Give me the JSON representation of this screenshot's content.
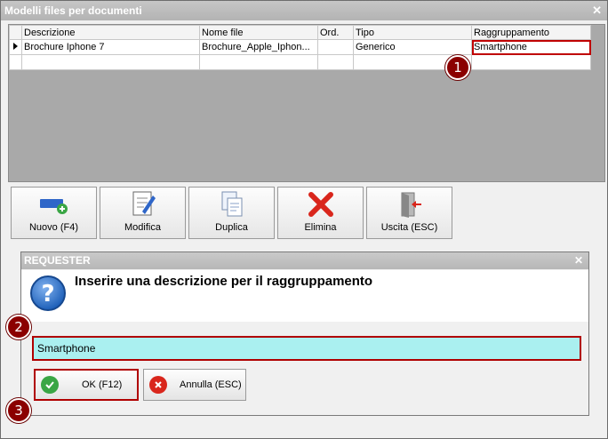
{
  "window": {
    "title": "Modelli files per documenti",
    "close_glyph": "✕"
  },
  "grid": {
    "columns": [
      "Descrizione",
      "Nome file",
      "Ord.",
      "Tipo",
      "Raggruppamento"
    ],
    "rows": [
      {
        "descrizione": "Brochure Iphone 7",
        "nome_file": "Brochure_Apple_Iphon...",
        "ord": "",
        "tipo": "Generico",
        "raggruppamento": "Smartphone"
      }
    ]
  },
  "toolbar": {
    "nuovo": "Nuovo (F4)",
    "modifica": "Modifica",
    "duplica": "Duplica",
    "elimina": "Elimina",
    "uscita": "Uscita (ESC)"
  },
  "requester": {
    "title": "REQUESTER",
    "close_glyph": "✕",
    "message": "Inserire una descrizione per il raggruppamento",
    "input_value": "Smartphone",
    "ok_label": "OK (F12)",
    "annulla_label": "Annulla (ESC)"
  },
  "badges": [
    "1",
    "2",
    "3"
  ],
  "colors": {
    "highlight": "#c00000",
    "badge": "#8b0000",
    "input_bg": "#aaf0f0",
    "delete_red": "#d9261c",
    "ok_green": "#3aa645",
    "help_blue": "#1d5fb8"
  }
}
